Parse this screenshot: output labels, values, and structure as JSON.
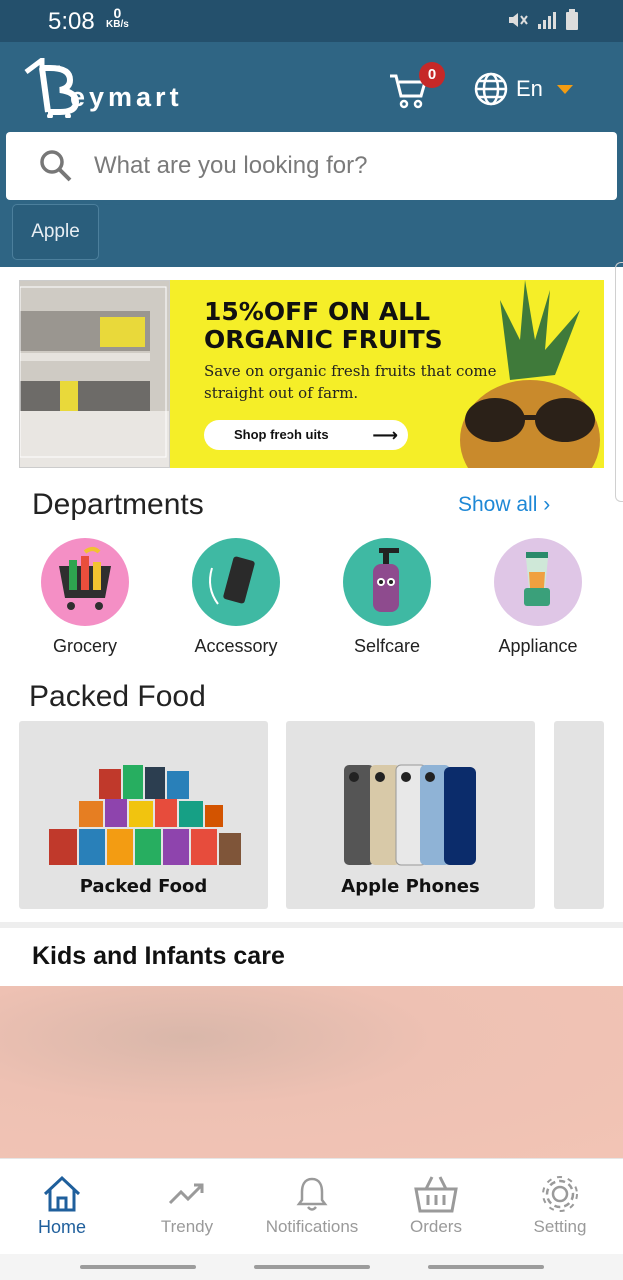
{
  "status_bar": {
    "time": "5:08",
    "speed_value": "0",
    "speed_unit": "KB/s"
  },
  "header": {
    "brand": "eymart",
    "cart_count": "0",
    "language": "En",
    "search_placeholder": "What are you looking for?",
    "recent_chip": "Apple"
  },
  "banner": {
    "title_line1": "15%OFF ON ALL",
    "title_line2": "ORGANIC FRUITS",
    "subtitle": "Save on organic fresh fruits that come straight out of farm.",
    "button": "Shop freɔh   uits"
  },
  "departments": {
    "title": "Departments",
    "show_all": "Show all",
    "items": [
      {
        "label": "Grocery",
        "color": "#f48fc5",
        "icon": "shopping-cart-icon"
      },
      {
        "label": "Accessory",
        "color": "#3fb9a3",
        "icon": "phone-icon"
      },
      {
        "label": "Selfcare",
        "color": "#3fb9a3",
        "icon": "soap-bottle-icon"
      },
      {
        "label": "Appliance",
        "color": "#dfc6e6",
        "icon": "blender-icon"
      }
    ]
  },
  "packed_food": {
    "title": "Packed Food",
    "cards": [
      {
        "label": "Packed Food"
      },
      {
        "label": "Apple Phones"
      }
    ]
  },
  "kids": {
    "title": "Kids and Infants care"
  },
  "bottom_nav": {
    "items": [
      {
        "label": "Home",
        "active": true
      },
      {
        "label": "Trendy"
      },
      {
        "label": "Notifications"
      },
      {
        "label": "Orders"
      },
      {
        "label": "Setting"
      }
    ]
  },
  "colors": {
    "header_bg": "#2f6584",
    "accent": "#1e88d6",
    "badge": "#c62828"
  }
}
